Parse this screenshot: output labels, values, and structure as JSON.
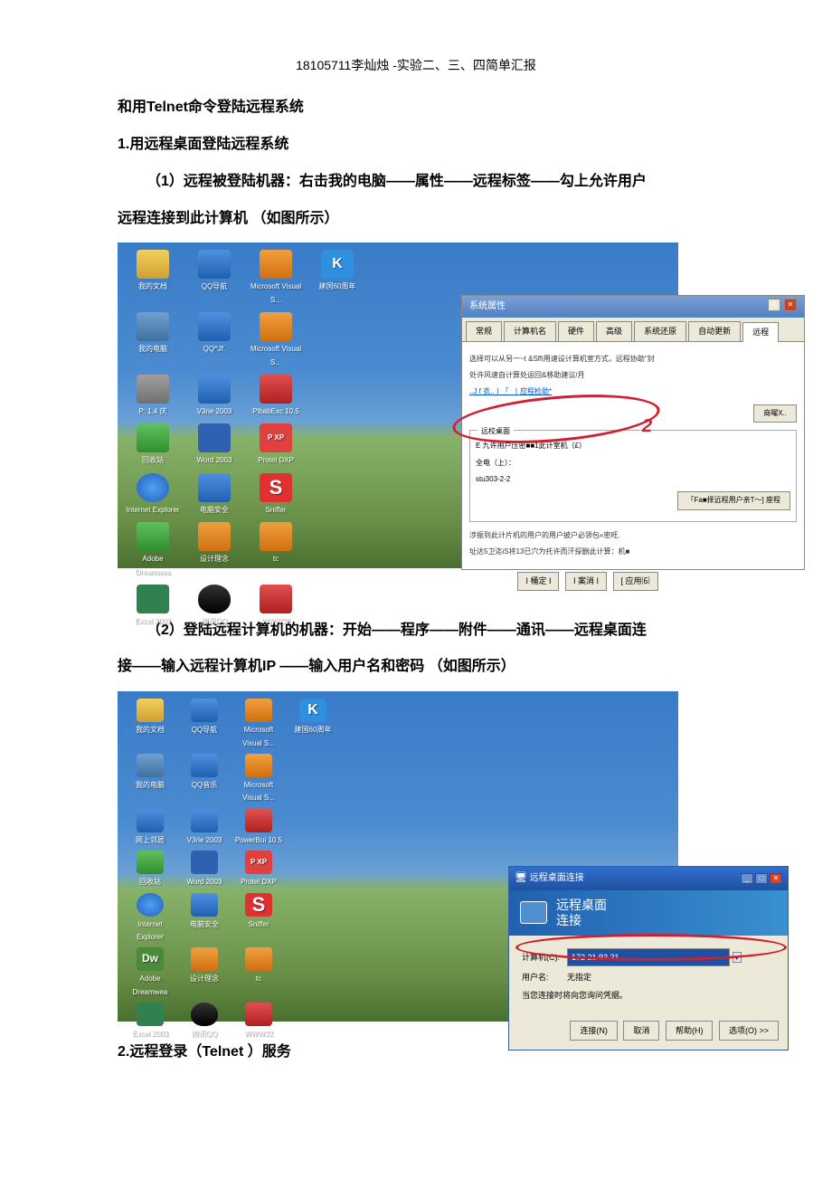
{
  "header": "18105711李灿烛 -实验二、三、四简单汇报",
  "title": "和用Telnet命令登陆远程系统",
  "section1": "1.用远程桌面登陆远程系统",
  "step1": "（1）远程被登陆机器：右击我的电脑——属性——远程标签——勾上允许用户",
  "step1b": "远程连接到此计算机 （如图所示）",
  "step2": "（2）登陆远程计算机的机器：开始——程序——附件——通讯——远程桌面连",
  "step2b": "接——输入远程计算机IP ——输入用户名和密码 （如图所示）",
  "section2": "2.远程登录（Telnet ）服务",
  "icons": {
    "mydoc": "我的文档",
    "qqfav": "QQ导航",
    "vs": "Microsoft Visual S...",
    "kk": "建国60周年",
    "mycomp": "我的电脑",
    "qqjf": "QQ^Jf.",
    "vs2": "Microsoft Visual S...",
    "drive": "P: 1.4 庆",
    "visio": "V3rie 2003",
    "pb": "PlbabExc 10.5",
    "recycle": "回收站",
    "word": "Word 2003",
    "protel": "Protel DXP",
    "ie": "Internet Explorer",
    "diannao": "电脑安全",
    "sniffer": "Sniffer",
    "adobe": "Adobe Dreamwea",
    "design": "设计理念",
    "tt": "tc",
    "excel": "Excel 2003",
    "tencent": "腾讯QQ",
    "www": "WWW32",
    "netplace": "网上邻居",
    "qqmusic": "QQ音乐",
    "powerbui": "PowerBui 10.5"
  },
  "sysprops": {
    "title": "系统属性",
    "tabs": {
      "general": "常规",
      "compname": "计算机名",
      "hardware": "硬件",
      "advanced": "高级",
      "sysrestore": "系统还原",
      "autoupdate": "自动更新",
      "remote": "远程"
    },
    "line1": "选择可以从另一~t &Sffi用速设计算机室方式，远程协助\"封",
    "line2": "处许风速自计算处运回&移助建议/月",
    "line3": "..J f 衣..丨「_丨应程检助*",
    "btn_edit": "商曜X..",
    "group_title": "远校桌面",
    "checkbox": "E 九许用户压密■■1此计室机（£）",
    "fullname_label": "全电（上）：",
    "fullname": "stu303-2-2",
    "select_users": "「Fa■择远程用户亲T〜] 座程",
    "note1": "涉振到此计片机的用户的用户披户必领包«密旺.",
    "note2": "址达5卫迄iS将13已穴为托许而汗探删此计算：机■",
    "ok": "I 桶定 I",
    "cancel": "I 案消 I",
    "apply": "[ 应用⑹"
  },
  "rdc": {
    "title": "远程桌面连接",
    "banner1": "远程桌面",
    "banner2": "连接",
    "computer_label": "计算机(C):",
    "computer_value": "172 21 92 21",
    "user_label": "用户名:",
    "user_value": "无指定",
    "note": "当您连接时将向您询问凭据。",
    "btn_connect": "连接(N)",
    "btn_cancel": "取消",
    "btn_help": "帮助(H)",
    "btn_options": "选项(O) >>"
  }
}
